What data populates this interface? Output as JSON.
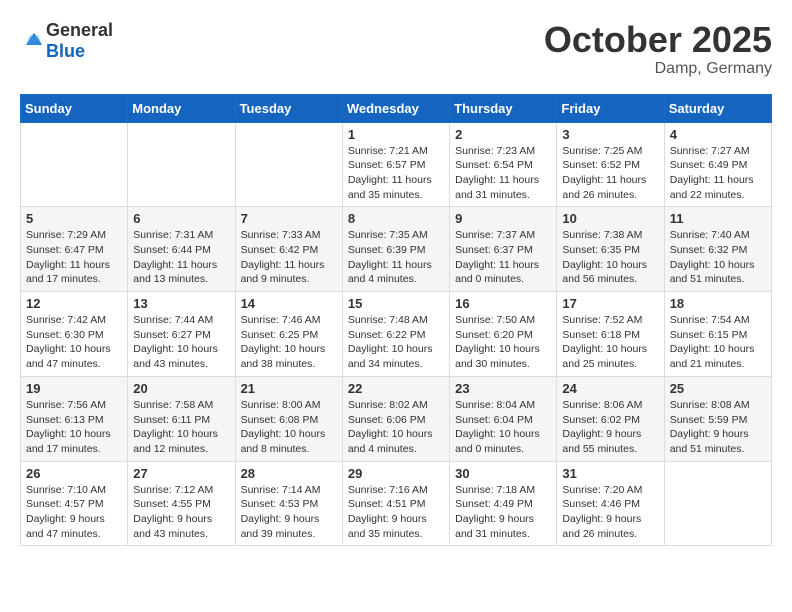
{
  "header": {
    "logo": {
      "text1": "General",
      "text2": "Blue"
    },
    "title": "October 2025",
    "location": "Damp, Germany"
  },
  "weekdays": [
    "Sunday",
    "Monday",
    "Tuesday",
    "Wednesday",
    "Thursday",
    "Friday",
    "Saturday"
  ],
  "weeks": [
    [
      {
        "day": "",
        "info": ""
      },
      {
        "day": "",
        "info": ""
      },
      {
        "day": "",
        "info": ""
      },
      {
        "day": "1",
        "info": "Sunrise: 7:21 AM\nSunset: 6:57 PM\nDaylight: 11 hours\nand 35 minutes."
      },
      {
        "day": "2",
        "info": "Sunrise: 7:23 AM\nSunset: 6:54 PM\nDaylight: 11 hours\nand 31 minutes."
      },
      {
        "day": "3",
        "info": "Sunrise: 7:25 AM\nSunset: 6:52 PM\nDaylight: 11 hours\nand 26 minutes."
      },
      {
        "day": "4",
        "info": "Sunrise: 7:27 AM\nSunset: 6:49 PM\nDaylight: 11 hours\nand 22 minutes."
      }
    ],
    [
      {
        "day": "5",
        "info": "Sunrise: 7:29 AM\nSunset: 6:47 PM\nDaylight: 11 hours\nand 17 minutes."
      },
      {
        "day": "6",
        "info": "Sunrise: 7:31 AM\nSunset: 6:44 PM\nDaylight: 11 hours\nand 13 minutes."
      },
      {
        "day": "7",
        "info": "Sunrise: 7:33 AM\nSunset: 6:42 PM\nDaylight: 11 hours\nand 9 minutes."
      },
      {
        "day": "8",
        "info": "Sunrise: 7:35 AM\nSunset: 6:39 PM\nDaylight: 11 hours\nand 4 minutes."
      },
      {
        "day": "9",
        "info": "Sunrise: 7:37 AM\nSunset: 6:37 PM\nDaylight: 11 hours\nand 0 minutes."
      },
      {
        "day": "10",
        "info": "Sunrise: 7:38 AM\nSunset: 6:35 PM\nDaylight: 10 hours\nand 56 minutes."
      },
      {
        "day": "11",
        "info": "Sunrise: 7:40 AM\nSunset: 6:32 PM\nDaylight: 10 hours\nand 51 minutes."
      }
    ],
    [
      {
        "day": "12",
        "info": "Sunrise: 7:42 AM\nSunset: 6:30 PM\nDaylight: 10 hours\nand 47 minutes."
      },
      {
        "day": "13",
        "info": "Sunrise: 7:44 AM\nSunset: 6:27 PM\nDaylight: 10 hours\nand 43 minutes."
      },
      {
        "day": "14",
        "info": "Sunrise: 7:46 AM\nSunset: 6:25 PM\nDaylight: 10 hours\nand 38 minutes."
      },
      {
        "day": "15",
        "info": "Sunrise: 7:48 AM\nSunset: 6:22 PM\nDaylight: 10 hours\nand 34 minutes."
      },
      {
        "day": "16",
        "info": "Sunrise: 7:50 AM\nSunset: 6:20 PM\nDaylight: 10 hours\nand 30 minutes."
      },
      {
        "day": "17",
        "info": "Sunrise: 7:52 AM\nSunset: 6:18 PM\nDaylight: 10 hours\nand 25 minutes."
      },
      {
        "day": "18",
        "info": "Sunrise: 7:54 AM\nSunset: 6:15 PM\nDaylight: 10 hours\nand 21 minutes."
      }
    ],
    [
      {
        "day": "19",
        "info": "Sunrise: 7:56 AM\nSunset: 6:13 PM\nDaylight: 10 hours\nand 17 minutes."
      },
      {
        "day": "20",
        "info": "Sunrise: 7:58 AM\nSunset: 6:11 PM\nDaylight: 10 hours\nand 12 minutes."
      },
      {
        "day": "21",
        "info": "Sunrise: 8:00 AM\nSunset: 6:08 PM\nDaylight: 10 hours\nand 8 minutes."
      },
      {
        "day": "22",
        "info": "Sunrise: 8:02 AM\nSunset: 6:06 PM\nDaylight: 10 hours\nand 4 minutes."
      },
      {
        "day": "23",
        "info": "Sunrise: 8:04 AM\nSunset: 6:04 PM\nDaylight: 10 hours\nand 0 minutes."
      },
      {
        "day": "24",
        "info": "Sunrise: 8:06 AM\nSunset: 6:02 PM\nDaylight: 9 hours\nand 55 minutes."
      },
      {
        "day": "25",
        "info": "Sunrise: 8:08 AM\nSunset: 5:59 PM\nDaylight: 9 hours\nand 51 minutes."
      }
    ],
    [
      {
        "day": "26",
        "info": "Sunrise: 7:10 AM\nSunset: 4:57 PM\nDaylight: 9 hours\nand 47 minutes."
      },
      {
        "day": "27",
        "info": "Sunrise: 7:12 AM\nSunset: 4:55 PM\nDaylight: 9 hours\nand 43 minutes."
      },
      {
        "day": "28",
        "info": "Sunrise: 7:14 AM\nSunset: 4:53 PM\nDaylight: 9 hours\nand 39 minutes."
      },
      {
        "day": "29",
        "info": "Sunrise: 7:16 AM\nSunset: 4:51 PM\nDaylight: 9 hours\nand 35 minutes."
      },
      {
        "day": "30",
        "info": "Sunrise: 7:18 AM\nSunset: 4:49 PM\nDaylight: 9 hours\nand 31 minutes."
      },
      {
        "day": "31",
        "info": "Sunrise: 7:20 AM\nSunset: 4:46 PM\nDaylight: 9 hours\nand 26 minutes."
      },
      {
        "day": "",
        "info": ""
      }
    ]
  ]
}
